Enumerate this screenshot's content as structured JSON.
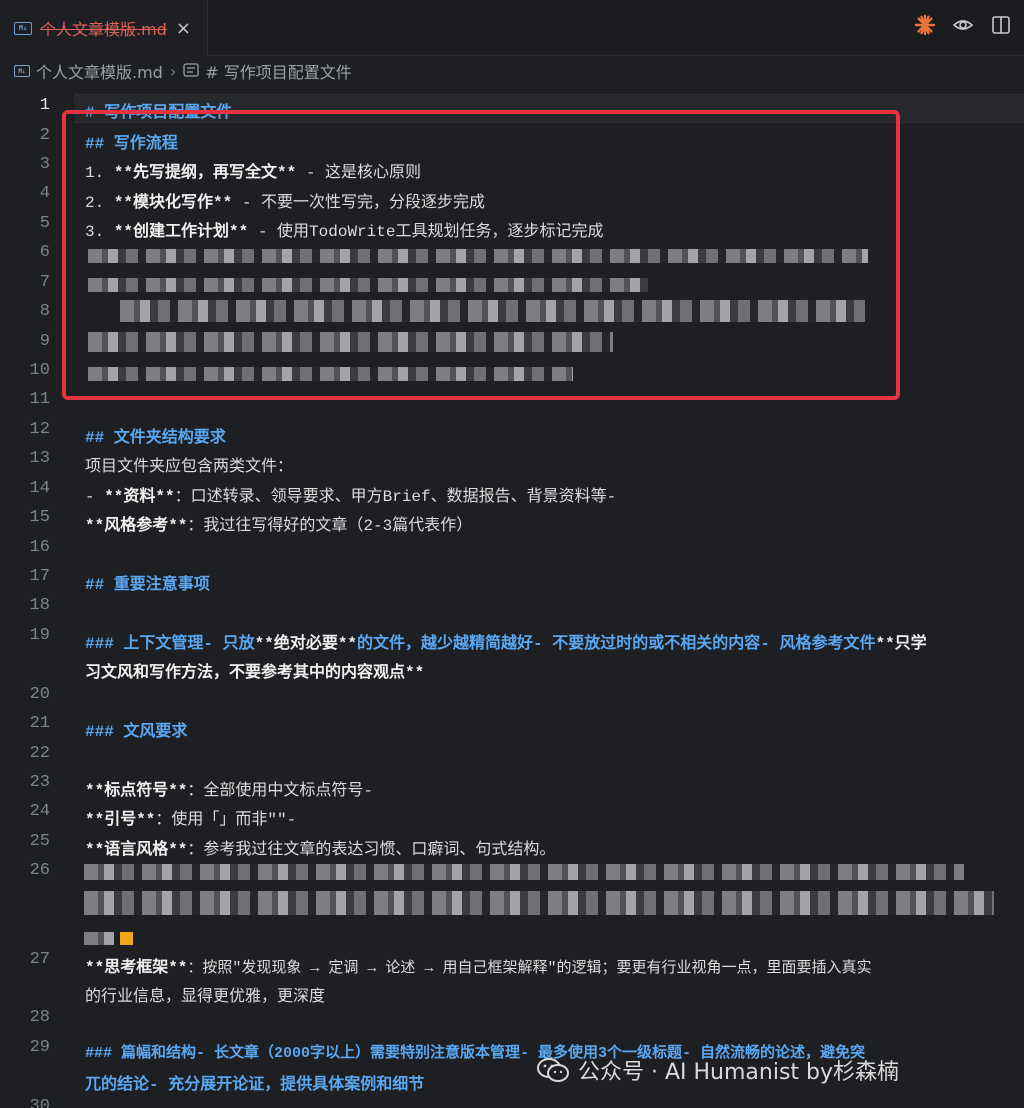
{
  "tab": {
    "filename": "个人文章模版.md",
    "file_icon": "markdown-icon",
    "close": "×"
  },
  "tab_actions": [
    "claude-spark-icon",
    "preview-eye-icon",
    "split-editor-icon"
  ],
  "breadcrumb": {
    "file": "个人文章模版.md",
    "separator": "›",
    "hash": "#",
    "section": "# 写作项目配置文件"
  },
  "editor": {
    "active_line": 1,
    "line_numbers": [
      "1",
      "2",
      "3",
      "4",
      "5",
      "6",
      "7",
      "8",
      "9",
      "10",
      "11",
      "12",
      "13",
      "14",
      "15",
      "16",
      "17",
      "18",
      "19",
      "20",
      "21",
      "22",
      "23",
      "24",
      "25",
      "26",
      "27",
      "28",
      "29",
      "30"
    ],
    "lines": {
      "l1": "# 写作项目配置文件",
      "l2": "## 写作流程",
      "l3a": "1. ",
      "l3b": "**先写提纲，再写全文**",
      "l3c": " - 这是核心原则",
      "l4a": "2. ",
      "l4b": "**模块化写作**",
      "l4c": " - 不要一次性写完，分段逐步完成",
      "l5a": "3. ",
      "l5b": "**创建工作计划**",
      "l5c": " - 使用TodoWrite工具规划任务，逐步标记完成",
      "l12": "## 文件夹结构要求",
      "l13": "项目文件夹应包含两类文件：",
      "l14a": "- ",
      "l14b": "**资料**",
      "l14c": "：口述转录、领导要求、甲方Brief、数据报告、背景资料等-",
      "l15a": "**风格参考**",
      "l15b": "：我过往写得好的文章（2-3篇代表作）",
      "l17": "## 重要注意事项",
      "l19a": "### 上下文管理- 只放",
      "l19b": "**绝对必要**",
      "l19c": "的文件，越少越精简越好- 不要放过时的或不相关的内容- 风格参考文件",
      "l19d": "**只学",
      "l19e": "习文风和写作方法，不要参考其中的内容观点**",
      "l21": "### 文风要求",
      "l23a": "**标点符号**",
      "l23b": "：全部使用中文标点符号-",
      "l24a": "**引号**",
      "l24b": "：使用「」而非\"\"-",
      "l25a": "**语言风格**",
      "l25b": "：参考我过往文章的表达习惯、口癖词、句式结构。",
      "l27a": "**思考框架**",
      "l27b": "：按照\"发现现象 → 定调 → 论述 → 用自己框架解释\"的逻辑；要更有行业视角一点，里面要插入真实",
      "l27c": "的行业信息，显得更优雅，更深度",
      "l29a": "### 篇幅和结构- 长文章（2000字以上）需要特别注意版本管理- 最多使用3个一级标题- 自然流畅的论述，避免突",
      "l29b": "兀的结论- 充分展开论证，提供具体案例和细节"
    }
  },
  "watermark": {
    "text": "公众号 · AI Humanist by杉森楠",
    "icon": "wechat-icon"
  },
  "colors": {
    "accent_heading": "#5aa7f2",
    "tab_modified": "#e0605a",
    "highlight_box": "#e5333f",
    "spark": "#e8743b"
  }
}
